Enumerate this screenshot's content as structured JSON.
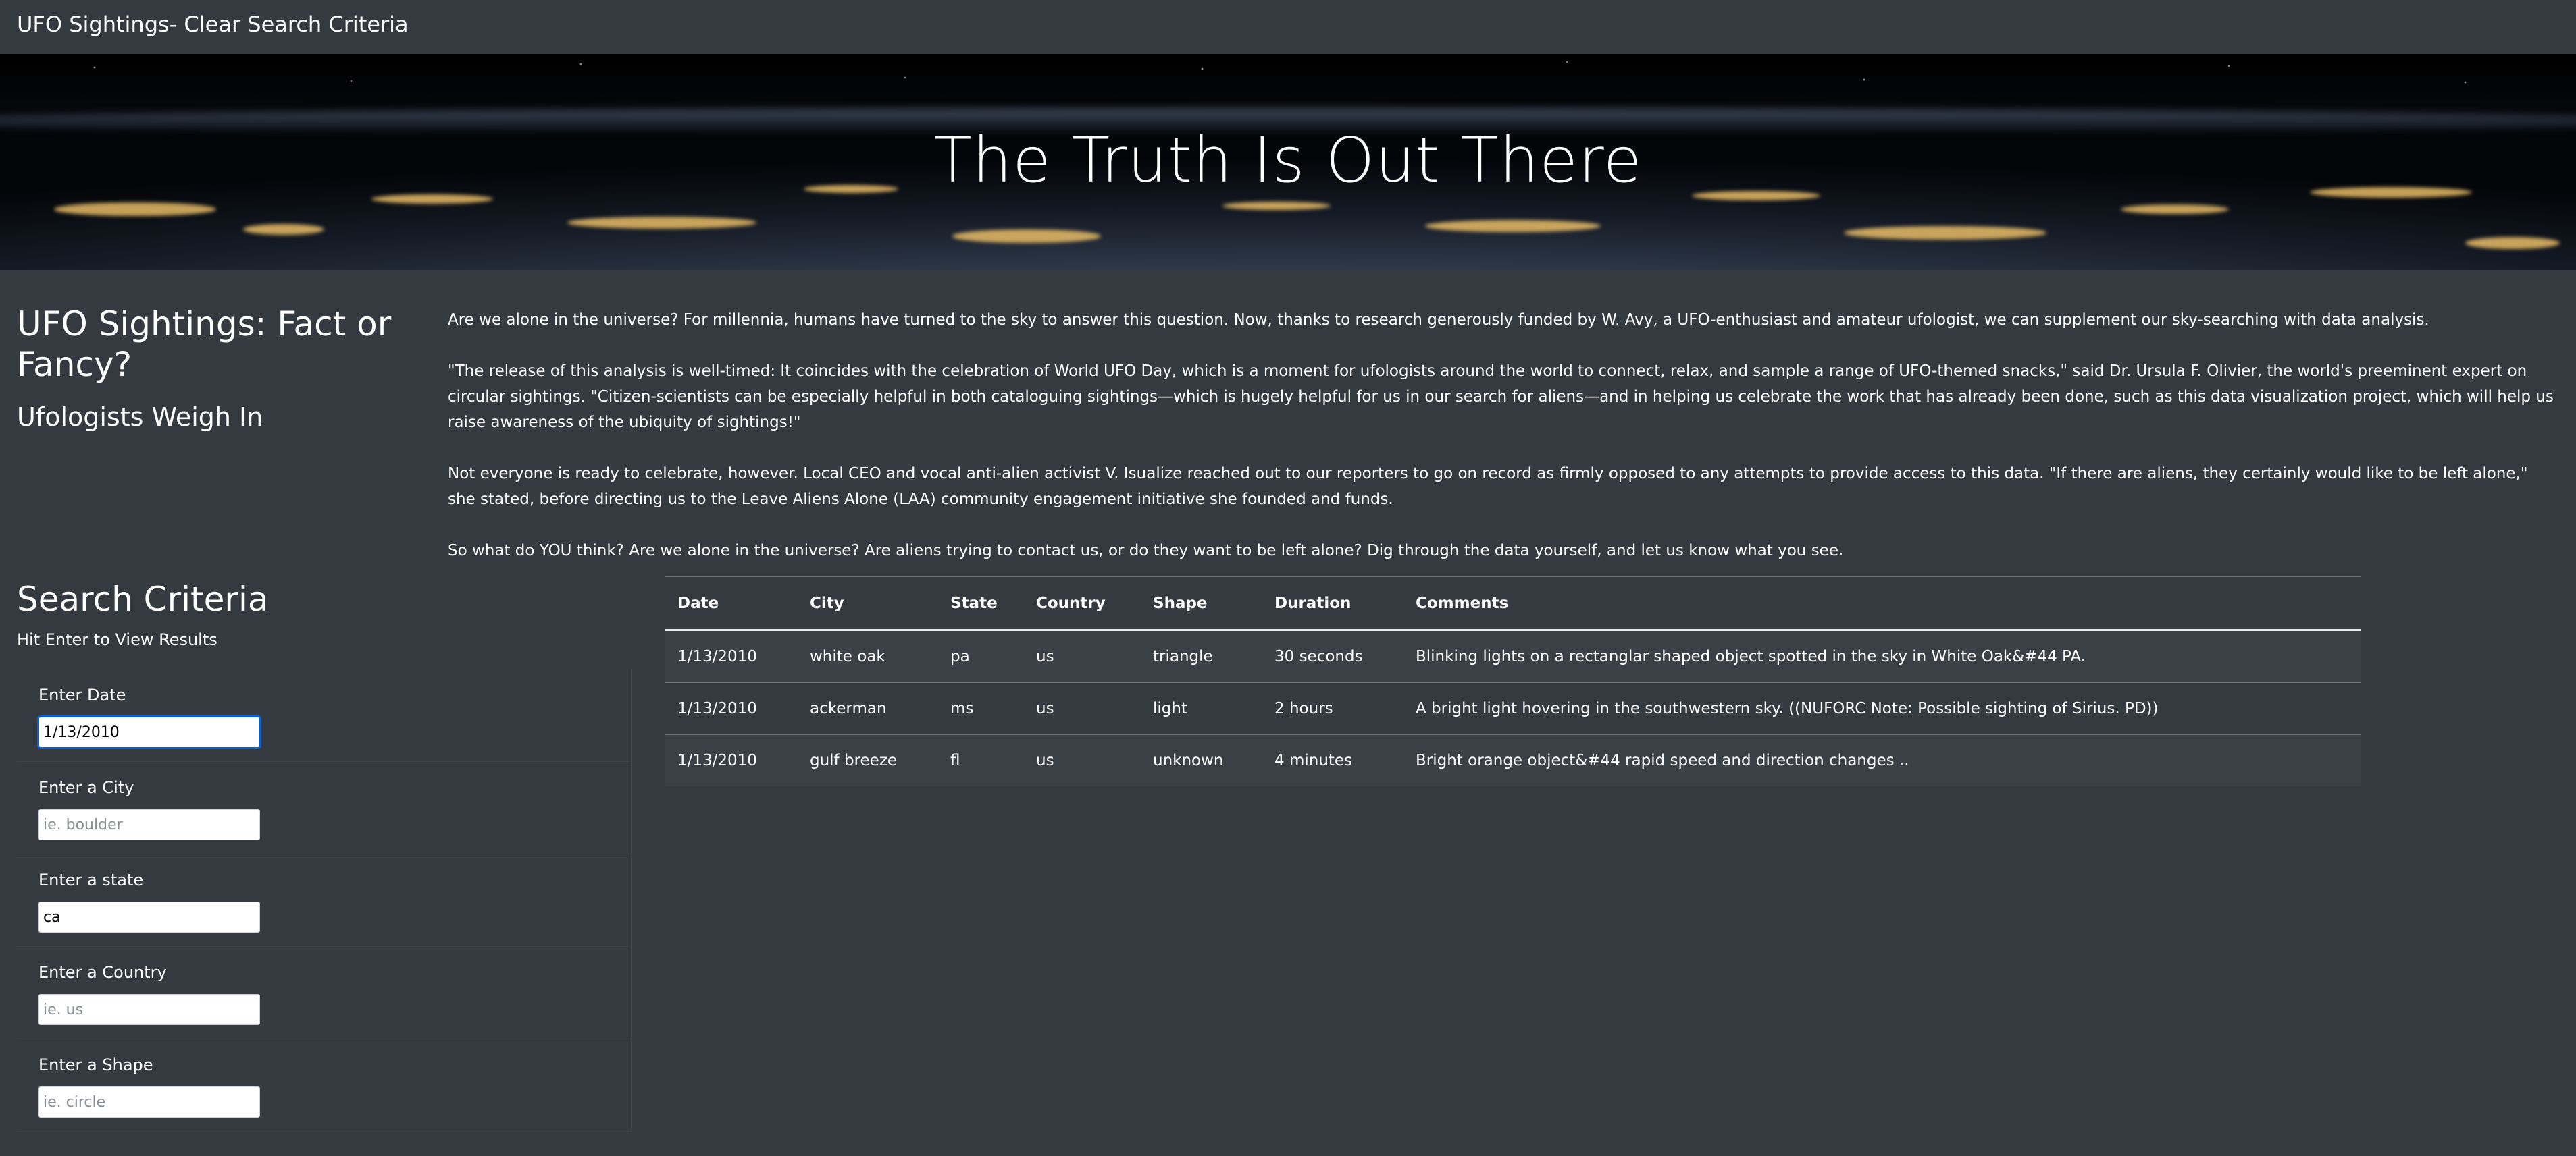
{
  "navbar": {
    "brand": "UFO Sightings- Clear Search Criteria"
  },
  "hero": {
    "title": "The Truth Is Out There"
  },
  "article": {
    "title": "UFO Sightings: Fact or Fancy?",
    "subtitle": "Ufologists Weigh In",
    "paragraphs": [
      "Are we alone in the universe? For millennia, humans have turned to the sky to answer this question. Now, thanks to research generously funded by W. Avy, a UFO-enthusiast and amateur ufologist, we can supplement our sky-searching with data analysis.",
      "\"The release of this analysis is well-timed: It coincides with the celebration of World UFO Day, which is a moment for ufologists around the world to connect, relax, and sample a range of UFO-themed snacks,\" said Dr. Ursula F. Olivier, the world's preeminent expert on circular sightings. \"Citizen-scientists can be especially helpful in both cataloguing sightings—which is hugely helpful for us in our search for aliens—and in helping us celebrate the work that has already been done, such as this data visualization project, which will help us raise awareness of the ubiquity of sightings!\"",
      "Not everyone is ready to celebrate, however. Local CEO and vocal anti-alien activist V. Isualize reached out to our reporters to go on record as firmly opposed to any attempts to provide access to this data. \"If there are aliens, they certainly would like to be left alone,\" she stated, before directing us to the Leave Aliens Alone (LAA) community engagement initiative she founded and funds.",
      "So what do YOU think? Are we alone in the universe? Are aliens trying to contact us, or do they want to be left alone? Dig through the data yourself, and let us know what you see."
    ]
  },
  "search": {
    "title": "Search Criteria",
    "hint": "Hit Enter to View Results",
    "filters": [
      {
        "label": "Enter Date",
        "value": "1/13/2010",
        "placeholder": ""
      },
      {
        "label": "Enter a City",
        "value": "",
        "placeholder": "ie. boulder"
      },
      {
        "label": "Enter a state",
        "value": "ca",
        "placeholder": ""
      },
      {
        "label": "Enter a Country",
        "value": "",
        "placeholder": "ie. us"
      },
      {
        "label": "Enter a Shape",
        "value": "",
        "placeholder": "ie. circle"
      }
    ]
  },
  "table": {
    "headers": [
      "Date",
      "City",
      "State",
      "Country",
      "Shape",
      "Duration",
      "Comments"
    ],
    "rows": [
      [
        "1/13/2010",
        "white oak",
        "pa",
        "us",
        "triangle",
        "30 seconds",
        "Blinking lights on a rectanglar shaped object spotted in the sky in White Oak&#44 PA."
      ],
      [
        "1/13/2010",
        "ackerman",
        "ms",
        "us",
        "light",
        "2 hours",
        "A bright light hovering in the southwestern sky. ((NUFORC Note: Possible sighting of Sirius. PD))"
      ],
      [
        "1/13/2010",
        "gulf breeze",
        "fl",
        "us",
        "unknown",
        "4 minutes",
        "Bright orange object&#44 rapid speed and direction changes .."
      ]
    ]
  }
}
